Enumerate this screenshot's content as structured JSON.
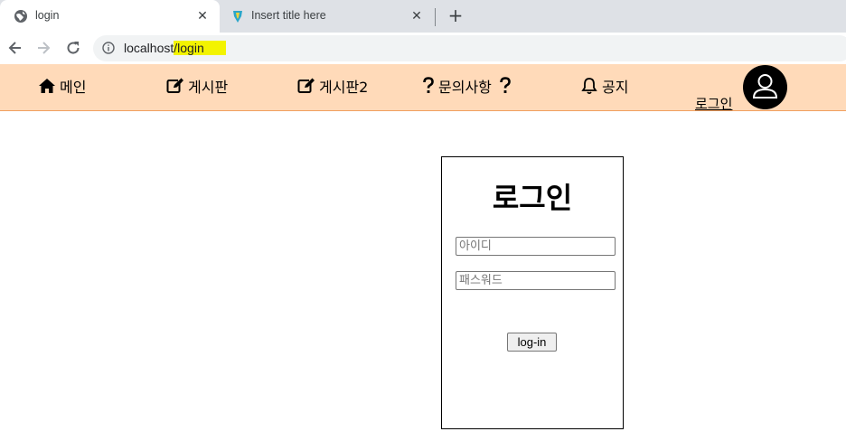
{
  "browser": {
    "tabs": [
      {
        "title": "login",
        "active": true
      },
      {
        "title": "Insert title here",
        "active": false
      }
    ],
    "new_tab_label": "+",
    "url_host": "localhost",
    "url_path": "/login"
  },
  "nav": {
    "items": [
      {
        "label": "메인",
        "icon": "home-icon"
      },
      {
        "label": "게시판",
        "icon": "edit-icon"
      },
      {
        "label": "게시판2",
        "icon": "edit-icon"
      },
      {
        "label": "문의사항",
        "icon": "question-icon"
      },
      {
        "label": "공지",
        "icon": "bell-icon"
      }
    ],
    "login_link": "로그인",
    "avatar_icon": "user-icon",
    "background": "#ffdab9"
  },
  "login": {
    "title": "로그인",
    "id_placeholder": "아이디",
    "pw_placeholder": "패스워드",
    "button_label": "log-in"
  }
}
